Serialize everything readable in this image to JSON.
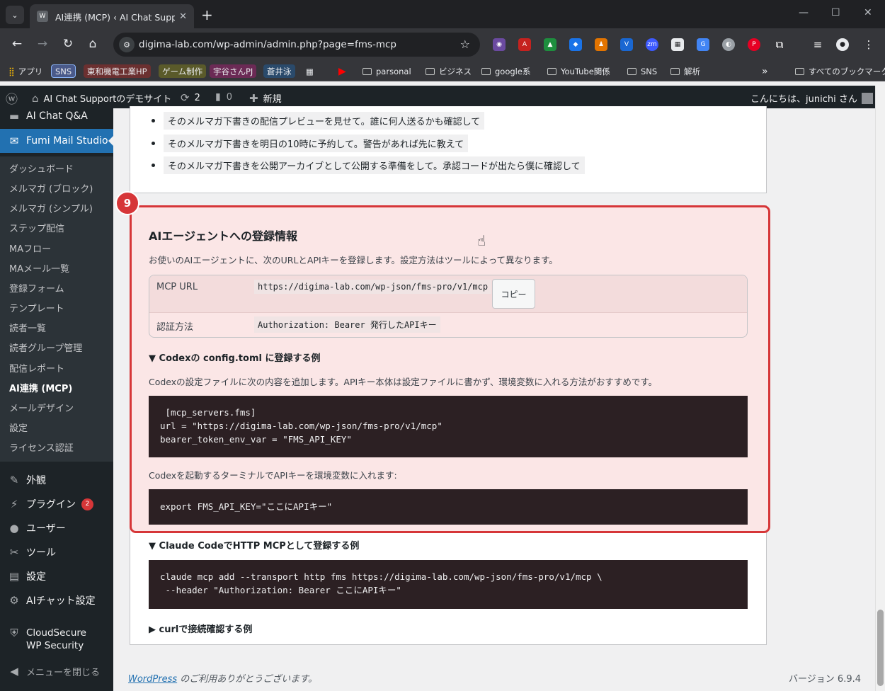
{
  "browser": {
    "tab_title": "AI連携 (MCP) ‹ AI Chat Support のデモサイト",
    "url": "digima-lab.com/wp-admin/admin.php?page=fms-mcp",
    "bookmarks": [
      {
        "label": "アプリ"
      },
      {
        "label": "SNS",
        "color": "#4a5a8a"
      },
      {
        "label": "東和機電工業HP",
        "color": "#6b3030"
      },
      {
        "label": "ゲーム制作",
        "color": "#5a5a2a"
      },
      {
        "label": "宇谷さんPJ",
        "color": "#6b2a55"
      },
      {
        "label": "蒼井泳",
        "color": "#2a4a6b"
      }
    ],
    "bookmark_folders": [
      "parsonal",
      "ビジネス",
      "google系",
      "YouTube関係",
      "SNS",
      "解析"
    ],
    "all_bookmarks": "すべてのブックマーク"
  },
  "adminbar": {
    "site_name": "AI Chat Supportのデモサイト",
    "updates_count": "2",
    "comments_count": "0",
    "new_label": "新規",
    "greeting": "こんにちは、junichi さん"
  },
  "sidebar": {
    "top_item": "AI Chat Q&A",
    "active_plugin": "Fumi Mail Studio",
    "submenu": [
      "ダッシュボード",
      "メルマガ (ブロック)",
      "メルマガ (シンプル)",
      "ステップ配信",
      "MAフロー",
      "MAメール一覧",
      "登録フォーム",
      "テンプレート",
      "読者一覧",
      "読者グループ管理",
      "配信レポート",
      "AI連携 (MCP)",
      "メールデザイン",
      "設定",
      "ライセンス認証"
    ],
    "menu": [
      {
        "label": "外観",
        "icon": "brush-icon"
      },
      {
        "label": "プラグイン",
        "icon": "plugin-icon",
        "badge": "2"
      },
      {
        "label": "ユーザー",
        "icon": "user-icon"
      },
      {
        "label": "ツール",
        "icon": "wrench-icon"
      },
      {
        "label": "設定",
        "icon": "settings-icon"
      },
      {
        "label": "AIチャット設定",
        "icon": "gear-icon"
      },
      {
        "label": "CloudSecure WP Security",
        "icon": "shield-icon"
      }
    ],
    "collapse_label": "メニューを閉じる"
  },
  "main": {
    "prompts": [
      "そのメルマガ下書きの配信プレビューを見せて。誰に何人送るかも確認して",
      "そのメルマガ下書きを明日の10時に予約して。警告があれば先に教えて",
      "そのメルマガ下書きを公開アーカイブとして公開する準備をして。承認コードが出たら僕に確認して"
    ],
    "step_number": "9",
    "section_title": "AIエージェントへの登録情報",
    "section_desc": "お使いのAIエージェントに、次のURLとAPIキーを登録します。設定方法はツールによって異なります。",
    "mcp_url_label": "MCP URL",
    "mcp_url": "https://digima-lab.com/wp-json/fms-pro/v1/mcp",
    "copy_label": "コピー",
    "auth_label": "認証方法",
    "auth_value": "Authorization: Bearer 発行したAPIキー",
    "codex_summary": "▼ Codexの config.toml に登録する例",
    "codex_desc": "Codexの設定ファイルに次の内容を追加します。APIキー本体は設定ファイルに書かず、環境変数に入れる方法がおすすめです。",
    "codex_code": " [mcp_servers.fms]\nurl = \"https://digima-lab.com/wp-json/fms-pro/v1/mcp\"\nbearer_token_env_var = \"FMS_API_KEY\"",
    "codex_env_desc": "Codexを起動するターミナルでAPIキーを環境変数に入れます:",
    "codex_env_code": "export FMS_API_KEY=\"ここにAPIキー\"",
    "claude_summary": "▼ Claude CodeでHTTP MCPとして登録する例",
    "claude_code": "claude mcp add --transport http fms https://digima-lab.com/wp-json/fms-pro/v1/mcp \\\n --header \"Authorization: Bearer ここにAPIキー\"",
    "curl_summary": "▶ curlで接続確認する例"
  },
  "footer": {
    "wp_link": "WordPress",
    "thanks": " のご利用ありがとうございます。",
    "version": "バージョン 6.9.4"
  }
}
